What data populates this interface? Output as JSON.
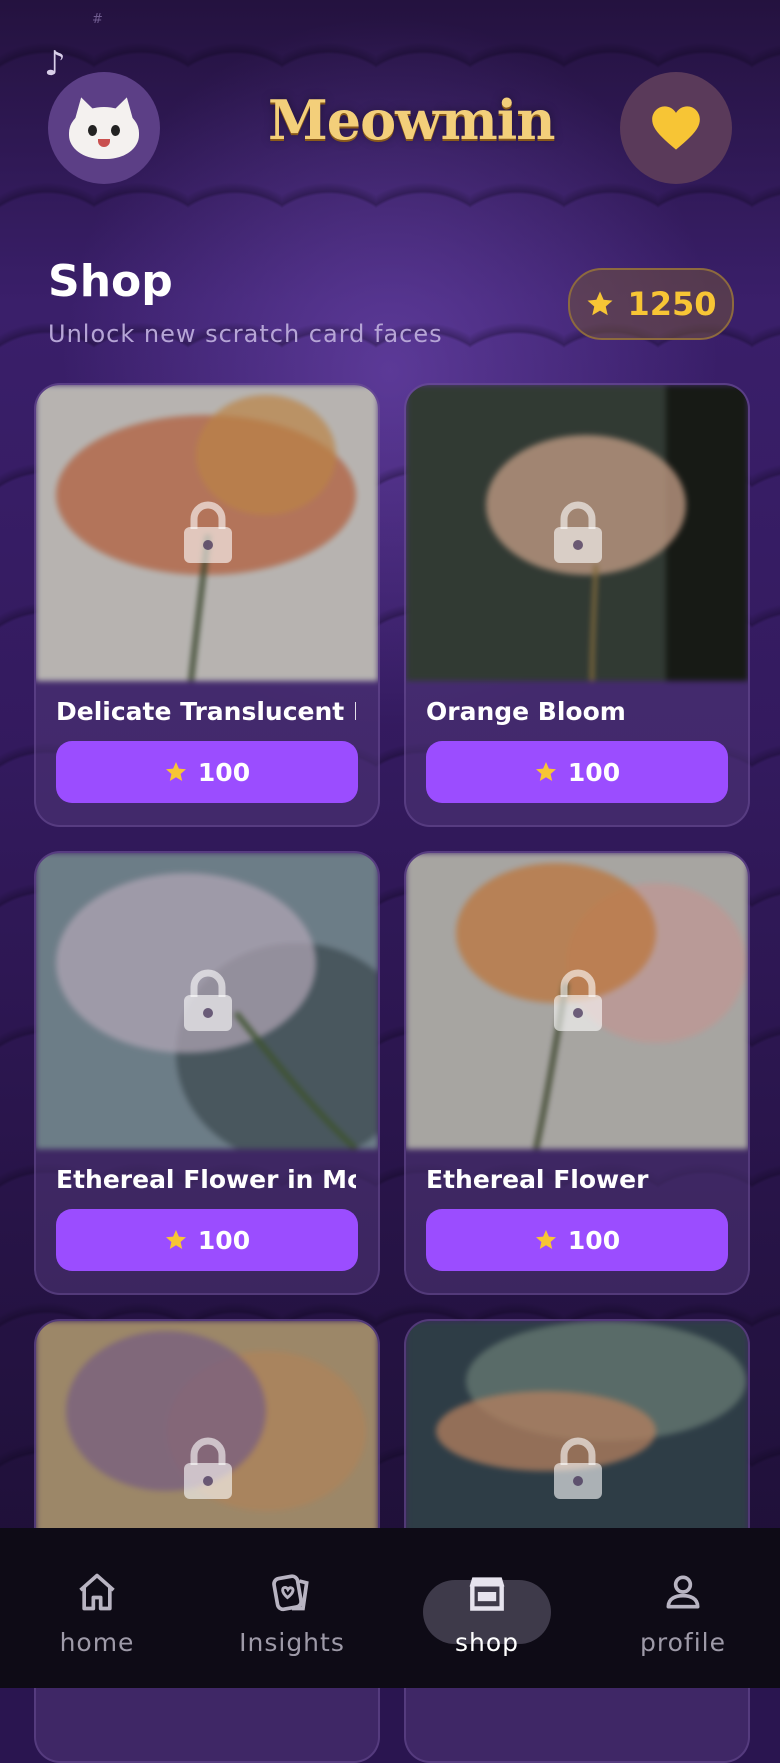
{
  "header": {
    "corner_mark": "#",
    "music_icon": "♪",
    "app_name": "Meowmin",
    "avatar": "cat-avatar",
    "favorites_icon": "heart-icon"
  },
  "page": {
    "title": "Shop",
    "subtitle": "Unlock new scratch card faces",
    "balance": "1250"
  },
  "colors": {
    "accent": "#9b4dff",
    "gold": "#f7c535",
    "logo": "#f3cf7a"
  },
  "items": [
    {
      "name": "Delicate Translucent F...",
      "price": "100",
      "locked": true,
      "palette": [
        "#eae6e2",
        "#e37a4f",
        "#f0a85a"
      ]
    },
    {
      "name": "Orange Bloom",
      "price": "100",
      "locked": true,
      "palette": [
        "#3f4a42",
        "#f2c3a6",
        "#151611"
      ]
    },
    {
      "name": "Ethereal Flower in Mot...",
      "price": "100",
      "locked": true,
      "palette": [
        "#8ba0ad",
        "#e7d5ea",
        "#3f4f55"
      ]
    },
    {
      "name": "Ethereal Flower",
      "price": "100",
      "locked": true,
      "palette": [
        "#d6d3cf",
        "#f0974e",
        "#f6c1ba"
      ]
    },
    {
      "name": "",
      "price": "",
      "locked": true,
      "palette": [
        "#c8ad85",
        "#9878a6",
        "#e0a772"
      ]
    },
    {
      "name": "",
      "price": "",
      "locked": true,
      "palette": [
        "#3b4e5a",
        "#e8a47a",
        "#a9c3b0"
      ]
    }
  ],
  "nav": [
    {
      "label": "home",
      "icon": "home-icon",
      "active": false
    },
    {
      "label": "Insights",
      "icon": "insights-icon",
      "active": false
    },
    {
      "label": "shop",
      "icon": "store-icon",
      "active": true
    },
    {
      "label": "profile",
      "icon": "person-icon",
      "active": false
    }
  ]
}
